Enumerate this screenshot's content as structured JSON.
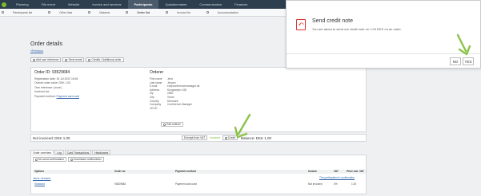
{
  "topnav": {
    "items": [
      "Planning",
      "File event",
      "Website",
      "Invoice and services",
      "Participants",
      "Questionnaires",
      "Communication",
      "Finances"
    ],
    "active_index": 4
  },
  "subnav": {
    "items": [
      "Participants list",
      "Other lists",
      "Material",
      "Order list",
      "Invoice list",
      "Accommodation"
    ],
    "active_index": 3
  },
  "page": {
    "title": "Order details",
    "back_link": "«Previous"
  },
  "toolbar": {
    "add_reference": "Add own reference",
    "send_email": "Send email",
    "credits": "Credits / Additional order"
  },
  "order": {
    "id_label": "Order ID: 93529684",
    "registration": "Registration date: 15 Jul 2022 16:54",
    "overall": "Overall order value: DKK 1.00",
    "own_reference": "Own reference: (none)",
    "invoiced": "Invoiced via:",
    "payment_method": "Payment method:",
    "payment_link": "Payment card card"
  },
  "customer": {
    "heading": "Orderer",
    "fields": [
      [
        "First name",
        "Jens"
      ],
      [
        "Last name",
        "Jensen"
      ],
      [
        "E-mail",
        "ex@conferencemanager.dk"
      ],
      [
        "Address",
        "Kongevejen 148"
      ],
      [
        "Zip",
        "2830"
      ],
      [
        "City",
        "Virum"
      ],
      [
        "Country",
        "Denmark"
      ],
      [
        "Company",
        "Conference Manager"
      ],
      [
        "LEI-ID",
        ""
      ]
    ],
    "edit_button": "Edit orderer"
  },
  "balance": {
    "not_invoiced": "Not invoiced: DKK 1.00",
    "exempt": "Exempt from VAT",
    "invoiced": "Invoiced",
    "credit": "Credit",
    "balance": "Balance: DKK 1.00"
  },
  "tabs": [
    "Order overview",
    "Log",
    "Card Transactions",
    "Headwares"
  ],
  "panel": {
    "no_send": "No send confirmation",
    "download": "Download confirmation",
    "columns": [
      "Options",
      "Order no",
      "Payment method",
      "Invoice",
      "VAT",
      "Price incl. VAT"
    ],
    "person": "Jens Jensen",
    "confirmation": "The participation's confirmation",
    "row": {
      "option": "Standard",
      "order_no": "93529684",
      "payment": "Payment card card",
      "invoice": "Not invoiced",
      "vat": "0%",
      "price": "1.00"
    }
  },
  "dialog": {
    "title": "Send credit note",
    "text": "You are about to send out credit note on 1.00 DKK on an order.",
    "no": "NO",
    "yes": "YES",
    "icon": "pdf-document-icon",
    "accent": "#d33333"
  },
  "colors": {
    "topbar": "#2d3e4e",
    "arrow": "#8bc34a"
  }
}
